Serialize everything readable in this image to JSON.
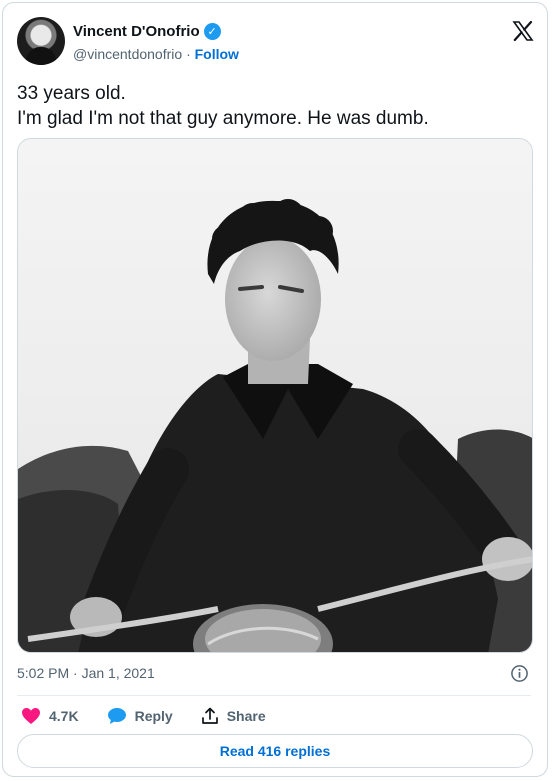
{
  "author": {
    "name": "Vincent D'Onofrio",
    "handle": "@vincentdonofrio",
    "separator": "·",
    "follow_label": "Follow",
    "verified": true
  },
  "tweet": {
    "lines": [
      "33 years old.",
      "I'm glad I'm not that guy anymore. He was dumb."
    ],
    "timestamp": "5:02 PM · Jan 1, 2021"
  },
  "media": {
    "description": "Black-and-white photo of a young man with curly hair in a dark leather jacket riding a motorcycle",
    "style": "monochrome"
  },
  "actions": {
    "like_count": "4.7K",
    "reply_label": "Reply",
    "share_label": "Share"
  },
  "read_replies_label": "Read 416 replies",
  "colors": {
    "like": "#f91880",
    "reply": "#1d9bf0",
    "link": "#006fd6",
    "muted": "#536471",
    "border": "#cfd9de"
  },
  "icons": [
    "x-logo-icon",
    "verified-badge-icon",
    "info-icon",
    "heart-icon",
    "reply-bubble-icon",
    "share-icon"
  ]
}
